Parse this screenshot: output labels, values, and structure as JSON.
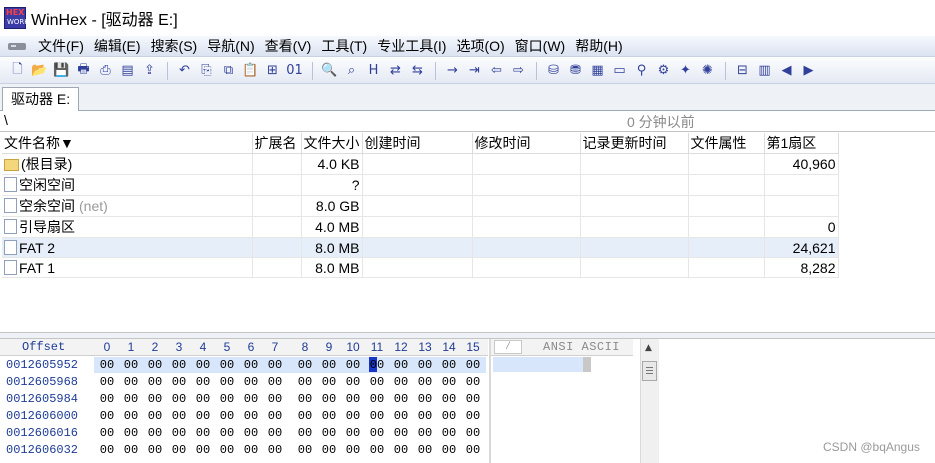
{
  "window": {
    "title": "WinHex - [驱动器 E:]",
    "logo_top": "HEX",
    "logo_bottom": "WORKS"
  },
  "menu": [
    "文件(F)",
    "编辑(E)",
    "搜索(S)",
    "导航(N)",
    "查看(V)",
    "工具(T)",
    "专业工具(I)",
    "选项(O)",
    "窗口(W)",
    "帮助(H)"
  ],
  "toolbar": {
    "groups": [
      [
        "new-file-icon",
        "open-file-icon",
        "save-icon",
        "print-icon",
        "print-preview-icon",
        "properties-icon",
        "export-icon"
      ],
      [
        "undo-icon",
        "copy-icon",
        "copy-block-icon",
        "paste-icon",
        "paste-special-icon",
        "binary-icon"
      ],
      [
        "find-icon",
        "find-next-icon",
        "find-hex-icon",
        "replace-icon",
        "replace-hex-icon"
      ],
      [
        "goto-offset-icon",
        "goto-sector-icon",
        "back-icon",
        "forward-icon"
      ],
      [
        "open-disk-icon",
        "disk-editor-icon",
        "ram-editor-icon",
        "calculator-icon",
        "analyze-icon",
        "disk-tools-icon",
        "clean-icon",
        "settings-icon"
      ],
      [
        "directory-browser-icon",
        "partition-icon",
        "prev-icon",
        "next-icon"
      ]
    ],
    "glyphs": {
      "new-file-icon": "🗋",
      "open-file-icon": "📂",
      "save-icon": "💾",
      "print-icon": "🖶",
      "print-preview-icon": "⎙",
      "properties-icon": "▤",
      "export-icon": "⇪",
      "undo-icon": "↶",
      "copy-icon": "⎘",
      "copy-block-icon": "⧉",
      "paste-icon": "📋",
      "paste-special-icon": "⊞",
      "binary-icon": "01",
      "find-icon": "🔍",
      "find-next-icon": "⌕",
      "find-hex-icon": "H",
      "replace-icon": "⇄",
      "replace-hex-icon": "⇆",
      "goto-offset-icon": "→",
      "goto-sector-icon": "⇥",
      "back-icon": "⇦",
      "forward-icon": "⇨",
      "open-disk-icon": "⛁",
      "disk-editor-icon": "⛃",
      "ram-editor-icon": "▦",
      "calculator-icon": "▭",
      "analyze-icon": "⚲",
      "disk-tools-icon": "⚙",
      "clean-icon": "✦",
      "settings-icon": "✺",
      "directory-browser-icon": "⊟",
      "partition-icon": "▥",
      "prev-icon": "◀",
      "next-icon": "▶"
    }
  },
  "tab": {
    "label": "驱动器 E:"
  },
  "path": {
    "current": "\\",
    "status": "0 分钟以前"
  },
  "directory": {
    "columns": [
      "文件名称▼",
      "扩展名",
      "文件大小",
      "创建时间",
      "修改时间",
      "记录更新时间",
      "文件属性",
      "第1扇区"
    ],
    "rows": [
      {
        "icon": "folder",
        "name": "(根目录)",
        "suffix": "",
        "ext": "",
        "size": "4.0 KB",
        "created": "",
        "modified": "",
        "record": "",
        "attr": "",
        "sector": "40,960",
        "selected": false
      },
      {
        "icon": "file",
        "name": "空闲空间",
        "suffix": "",
        "ext": "",
        "size": "?",
        "created": "",
        "modified": "",
        "record": "",
        "attr": "",
        "sector": "",
        "selected": false
      },
      {
        "icon": "file",
        "name": "空余空间",
        "suffix": "(net)",
        "ext": "",
        "size": "8.0 GB",
        "created": "",
        "modified": "",
        "record": "",
        "attr": "",
        "sector": "",
        "selected": false
      },
      {
        "icon": "file",
        "name": "引导扇区",
        "suffix": "",
        "ext": "",
        "size": "4.0 MB",
        "created": "",
        "modified": "",
        "record": "",
        "attr": "",
        "sector": "0",
        "selected": false
      },
      {
        "icon": "file",
        "name": "FAT 2",
        "suffix": "",
        "ext": "",
        "size": "8.0 MB",
        "created": "",
        "modified": "",
        "record": "",
        "attr": "",
        "sector": "24,621",
        "selected": true
      },
      {
        "icon": "file",
        "name": "FAT 1",
        "suffix": "",
        "ext": "",
        "size": "8.0 MB",
        "created": "",
        "modified": "",
        "record": "",
        "attr": "",
        "sector": "8,282",
        "selected": false
      }
    ]
  },
  "hex": {
    "offset_label": "Offset",
    "columns": [
      "0",
      "1",
      "2",
      "3",
      "4",
      "5",
      "6",
      "7",
      "8",
      "9",
      "10",
      "11",
      "12",
      "13",
      "14",
      "15"
    ],
    "rows": [
      {
        "offset": "0012605952",
        "bytes": [
          "00",
          "00",
          "00",
          "00",
          "00",
          "00",
          "00",
          "00",
          "00",
          "00",
          "00",
          "00",
          "00",
          "00",
          "00",
          "00"
        ],
        "highlight": true
      },
      {
        "offset": "0012605968",
        "bytes": [
          "00",
          "00",
          "00",
          "00",
          "00",
          "00",
          "00",
          "00",
          "00",
          "00",
          "00",
          "00",
          "00",
          "00",
          "00",
          "00"
        ],
        "highlight": false
      },
      {
        "offset": "0012605984",
        "bytes": [
          "00",
          "00",
          "00",
          "00",
          "00",
          "00",
          "00",
          "00",
          "00",
          "00",
          "00",
          "00",
          "00",
          "00",
          "00",
          "00"
        ],
        "highlight": false
      },
      {
        "offset": "0012606000",
        "bytes": [
          "00",
          "00",
          "00",
          "00",
          "00",
          "00",
          "00",
          "00",
          "00",
          "00",
          "00",
          "00",
          "00",
          "00",
          "00",
          "00"
        ],
        "highlight": false
      },
      {
        "offset": "0012606016",
        "bytes": [
          "00",
          "00",
          "00",
          "00",
          "00",
          "00",
          "00",
          "00",
          "00",
          "00",
          "00",
          "00",
          "00",
          "00",
          "00",
          "00"
        ],
        "highlight": false
      },
      {
        "offset": "0012606032",
        "bytes": [
          "00",
          "00",
          "00",
          "00",
          "00",
          "00",
          "00",
          "00",
          "00",
          "00",
          "00",
          "00",
          "00",
          "00",
          "00",
          "00"
        ],
        "highlight": false
      }
    ],
    "cursor_column": 11,
    "ansi_label": "ANSI ASCII",
    "ansi_tick": "⁄"
  },
  "watermark": "CSDN @bqAngus"
}
